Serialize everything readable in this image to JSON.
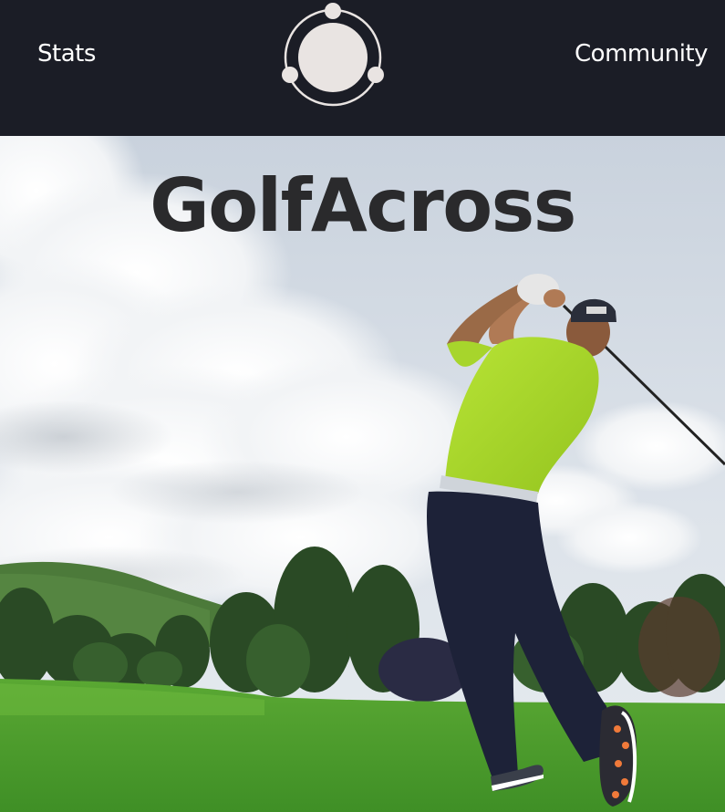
{
  "nav": {
    "left_label": "Stats",
    "right_label": "Community",
    "logo_icon": "orbit-logo-icon"
  },
  "hero": {
    "title": "GolfAcross",
    "image_subject": "golfer-swinging-on-fairway"
  },
  "colors": {
    "header_bg": "#1b1d26",
    "nav_text": "#ffffff",
    "logo": "#e9e4e2",
    "title": "#2a2a2c",
    "shirt": "#a8d92a",
    "grass": "#4fa02f"
  }
}
